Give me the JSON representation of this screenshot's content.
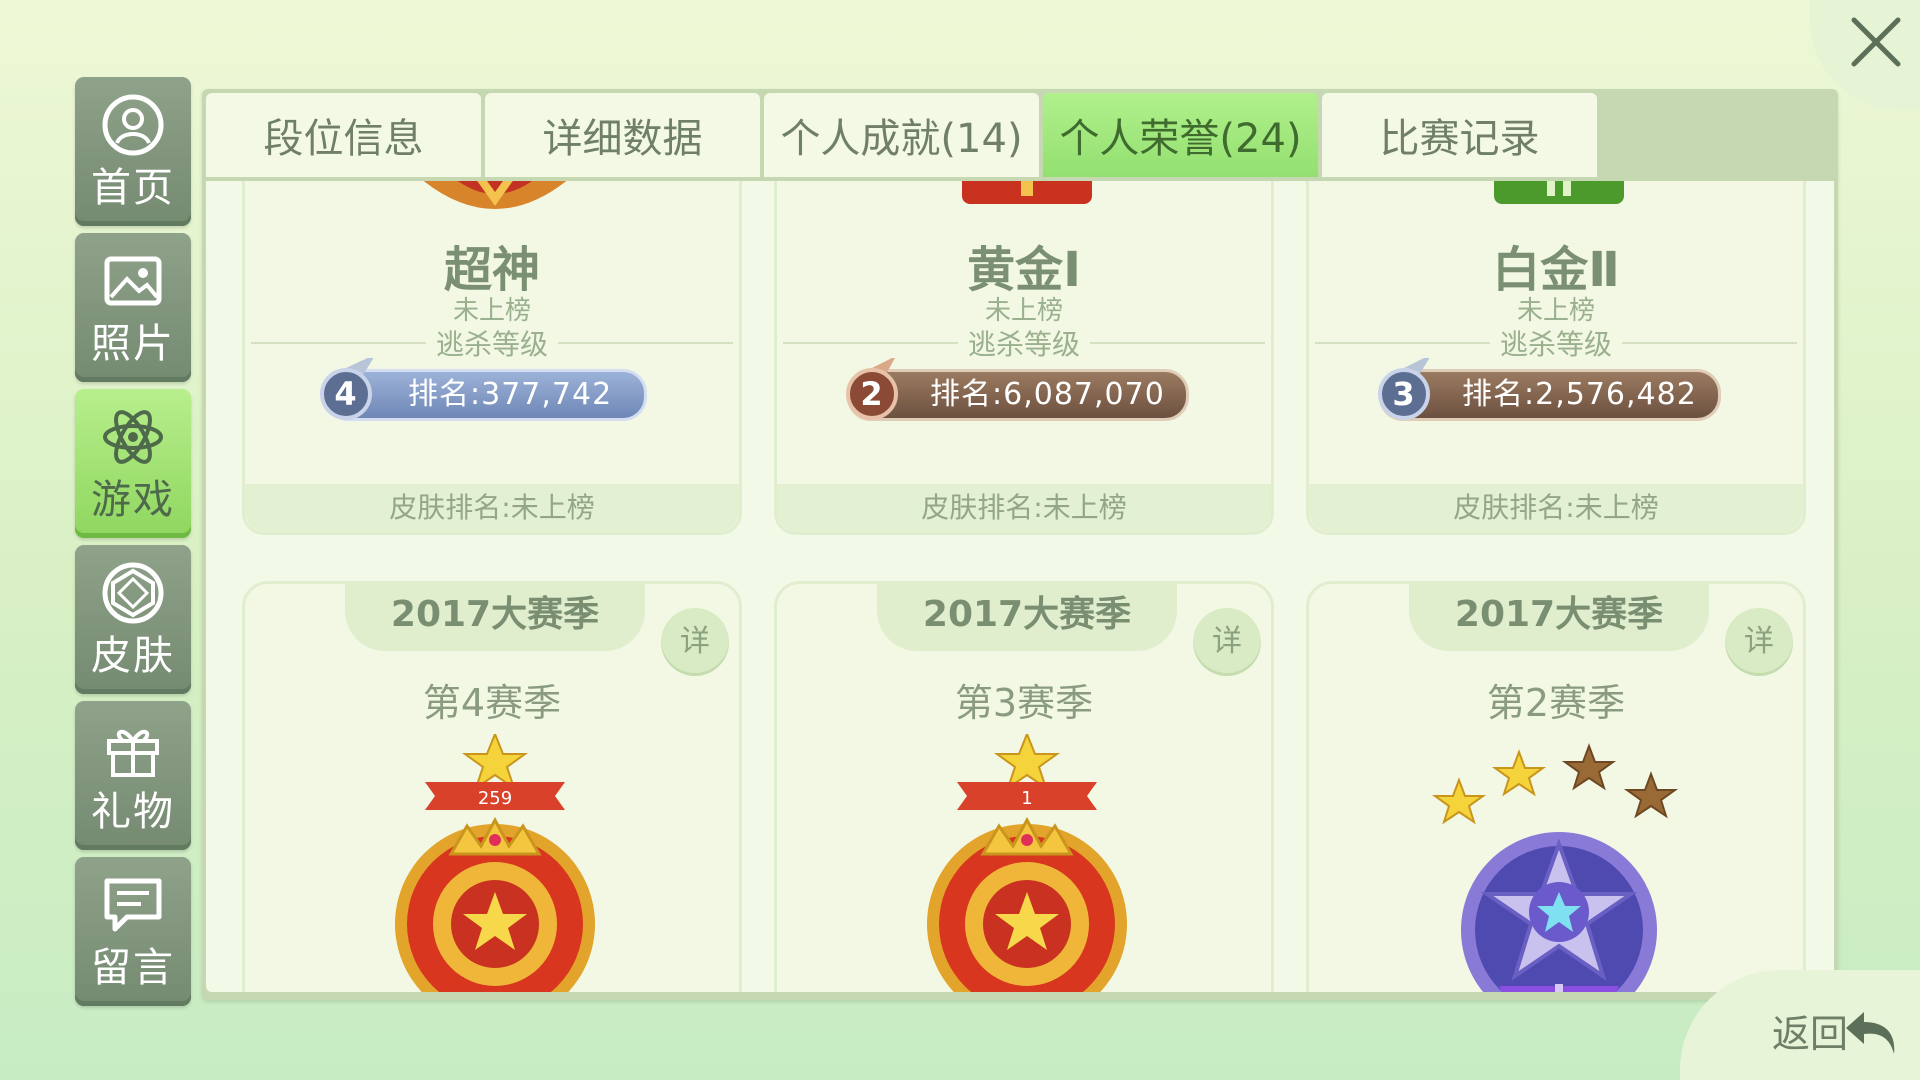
{
  "sidebar": {
    "items": [
      {
        "label": "首页",
        "icon": "home-icon"
      },
      {
        "label": "照片",
        "icon": "photo-icon"
      },
      {
        "label": "游戏",
        "icon": "atom-icon"
      },
      {
        "label": "皮肤",
        "icon": "skin-icon"
      },
      {
        "label": "礼物",
        "icon": "gift-icon"
      },
      {
        "label": "留言",
        "icon": "message-icon"
      }
    ],
    "active_index": 2
  },
  "tabs": [
    {
      "label": "段位信息"
    },
    {
      "label": "详细数据"
    },
    {
      "label": "个人成就(14)"
    },
    {
      "label": "个人荣誉(24)"
    },
    {
      "label": "比赛记录"
    }
  ],
  "active_tab": 3,
  "rank_cards": [
    {
      "title": "超神",
      "status": "未上榜",
      "divider": "逃杀等级",
      "rank_badge": "4",
      "rank_text": "排名:377,742",
      "footer": "皮肤排名:未上榜",
      "pill_color": "#8aa0c8"
    },
    {
      "title": "黄金Ⅰ",
      "status": "未上榜",
      "divider": "逃杀等级",
      "rank_badge": "2",
      "rank_text": "排名:6,087,070",
      "footer": "皮肤排名:未上榜",
      "pill_color": "#8a6a52"
    },
    {
      "title": "白金Ⅱ",
      "status": "未上榜",
      "divider": "逃杀等级",
      "rank_badge": "3",
      "rank_text": "排名:2,576,482",
      "footer": "皮肤排名:未上榜",
      "pill_color": "#8a6a52"
    }
  ],
  "season_cards": [
    {
      "banner": "2017大赛季",
      "detail": "详",
      "name": "第4赛季",
      "medal_number": "259",
      "medal_type": "gold-crown"
    },
    {
      "banner": "2017大赛季",
      "detail": "详",
      "name": "第3赛季",
      "medal_number": "1",
      "medal_type": "gold-crown"
    },
    {
      "banner": "2017大赛季",
      "detail": "详",
      "name": "第2赛季",
      "medal_type": "purple-star",
      "stars_gold": 2,
      "stars_total": 4
    }
  ],
  "back": {
    "label": "返回"
  },
  "colors": {
    "accent_green": "#93e070",
    "inactive_side": "#748a71"
  }
}
